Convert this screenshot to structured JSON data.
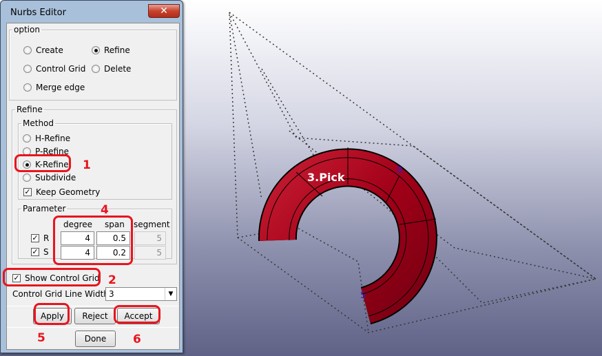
{
  "window": {
    "title": "Nurbs Editor",
    "close": "✕"
  },
  "option": {
    "legend": "option",
    "items": [
      {
        "label": "Create",
        "selected": false
      },
      {
        "label": "Refine",
        "selected": true
      },
      {
        "label": "Control Grid",
        "selected": false
      },
      {
        "label": "Delete",
        "selected": false
      },
      {
        "label": "Merge edge",
        "selected": false
      }
    ]
  },
  "refine": {
    "legend": "Refine",
    "method_legend": "Method",
    "methods": [
      {
        "label": "H-Refine",
        "selected": false
      },
      {
        "label": "P-Refine",
        "selected": false
      },
      {
        "label": "K-Refine",
        "selected": true
      },
      {
        "label": "Subdivide",
        "selected": false
      }
    ],
    "keep_geometry": {
      "label": "Keep Geometry",
      "checked": true
    }
  },
  "parameter": {
    "legend": "Parameter",
    "columns": [
      "degree",
      "span",
      "segment"
    ],
    "rows": [
      {
        "label": "R",
        "checked": true,
        "degree": "4",
        "span": "0.5",
        "segment": "5"
      },
      {
        "label": "S",
        "checked": true,
        "degree": "4",
        "span": "0.2",
        "segment": "5"
      }
    ]
  },
  "show_control_grid": {
    "label": "Show Control Grid",
    "checked": true
  },
  "line_width": {
    "label": "Control Grid Line Width:",
    "value": "3"
  },
  "buttons": {
    "apply": "Apply",
    "reject": "Reject",
    "accept": "Accept",
    "done": "Done"
  },
  "annotations": {
    "n1": "1",
    "n2": "2",
    "n4": "4",
    "n5": "5",
    "n6": "6",
    "pick": "3.Pick"
  },
  "viewport": {
    "label_r": "R",
    "label_s": "S",
    "surface_color": "#a00018"
  }
}
